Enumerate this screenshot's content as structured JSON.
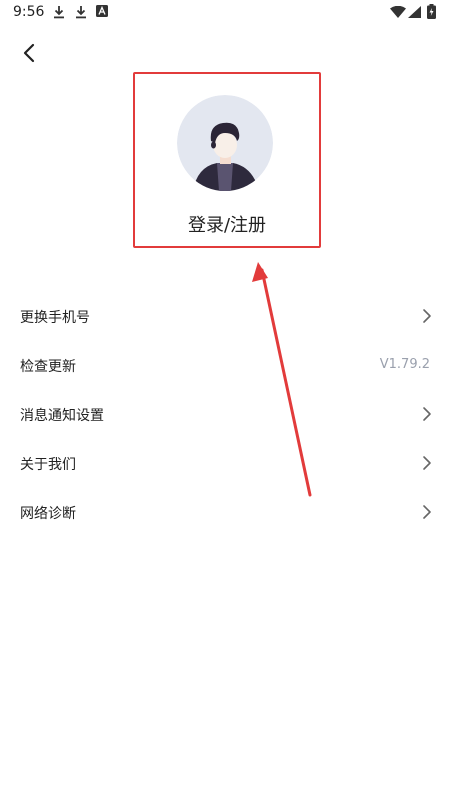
{
  "status_bar": {
    "time": "9:56",
    "icons": [
      "download-icon",
      "download-icon",
      "font-app-icon",
      "wifi-icon",
      "cellular-signal-icon",
      "battery-charging-icon"
    ]
  },
  "header": {
    "back_icon": "chevron-left-icon"
  },
  "profile": {
    "avatar_icon": "default-user-avatar-icon",
    "login_label": "登录/注册",
    "highlight_color": "#e23b3b"
  },
  "menu": {
    "items": [
      {
        "label": "更换手机号",
        "trailing": "chevron-right-icon"
      },
      {
        "label": "检查更新",
        "value": "V1.79.2"
      },
      {
        "label": "消息通知设置",
        "trailing": "chevron-right-icon"
      },
      {
        "label": "关于我们",
        "trailing": "chevron-right-icon"
      },
      {
        "label": "网络诊断",
        "trailing": "chevron-right-icon"
      }
    ]
  },
  "colors": {
    "accent_red": "#e23b3b",
    "value_gray": "#9aa0ad",
    "avatar_bg": "#e3e7f0"
  }
}
